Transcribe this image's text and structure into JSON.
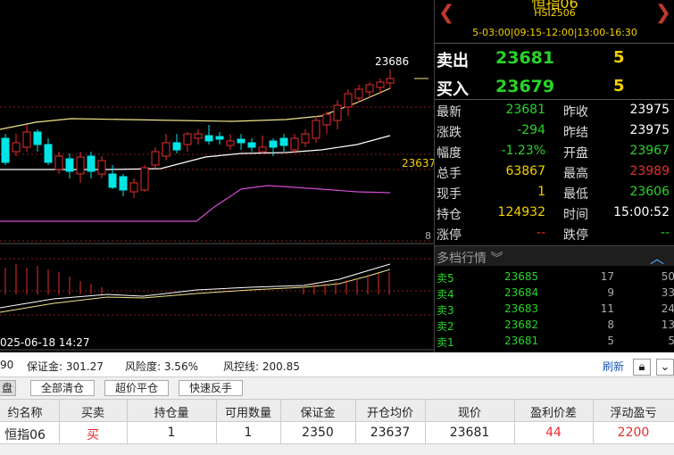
{
  "chart": {
    "high_label": "23686",
    "ma_label": "23637",
    "sub_label": "8",
    "datetime_label": "025-06-18 14:27",
    "colors": {
      "bull": "#e62e2e",
      "bear": "#00e5e5",
      "boll_up": "#f0e68c",
      "boll_mid": "#ffffff",
      "boll_dn": "#d24bd2",
      "macd_bar": "#e62e2e"
    }
  },
  "header": {
    "title": "恒指06",
    "code": "HSI2506",
    "sessions": "5-03:00|09:15-12:00|13:00-16:30"
  },
  "quote": {
    "sell_label": "卖出",
    "sell_price": "23681",
    "sell_vol": "5",
    "buy_label": "买入",
    "buy_price": "23679",
    "buy_vol": "5"
  },
  "stats": [
    {
      "l1": "最新",
      "v1": "23681",
      "c1": "g",
      "l2": "昨收",
      "v2": "23975",
      "c2": "w"
    },
    {
      "l1": "涨跌",
      "v1": "-294",
      "c1": "g",
      "l2": "昨结",
      "v2": "23975",
      "c2": "w"
    },
    {
      "l1": "幅度",
      "v1": "-1.23%",
      "c1": "g",
      "l2": "开盘",
      "v2": "23967",
      "c2": "g"
    },
    {
      "l1": "总手",
      "v1": "63867",
      "c1": "y",
      "l2": "最高",
      "v2": "23989",
      "c2": "r"
    },
    {
      "l1": "现手",
      "v1": "1",
      "c1": "y",
      "l2": "最低",
      "v2": "23606",
      "c2": "g"
    },
    {
      "l1": "持仓",
      "v1": "124932",
      "c1": "y",
      "l2": "时间",
      "v2": "15:00:52",
      "c2": "w"
    },
    {
      "l1": "涨停",
      "v1": "--",
      "c1": "r",
      "l2": "跌停",
      "v2": "--",
      "c2": "g"
    }
  ],
  "depth": {
    "title": "多档行情",
    "expand_icon": "double-chevron-down-icon",
    "collapse_icon": "chevron-up-icon",
    "rows": [
      {
        "label": "卖5",
        "price": "23685",
        "vol": "17",
        "cum": "50"
      },
      {
        "label": "卖4",
        "price": "23684",
        "vol": "9",
        "cum": "33"
      },
      {
        "label": "卖3",
        "price": "23683",
        "vol": "11",
        "cum": "24"
      },
      {
        "label": "卖2",
        "price": "23682",
        "vol": "8",
        "cum": "13"
      },
      {
        "label": "卖1",
        "price": "23681",
        "vol": "5",
        "cum": "5"
      }
    ]
  },
  "account": {
    "funds": "90",
    "margin": "保证金: 301.27",
    "risk": "风险度: 3.56%",
    "control": "风控线: 200.85",
    "refresh": "刷新"
  },
  "buttons": {
    "tab": "盘",
    "close_all": "全部清仓",
    "over_close": "超价平仓",
    "reverse": "快速反手"
  },
  "table": {
    "headers": [
      "约名称",
      "买卖",
      "持仓量",
      "可用数量",
      "保证金",
      "开仓均价",
      "现价",
      "盈利价差",
      "浮动盈亏"
    ],
    "row": [
      "恒指06",
      "买",
      "1",
      "1",
      "2350",
      "23637",
      "23681",
      "44",
      "2200"
    ]
  }
}
